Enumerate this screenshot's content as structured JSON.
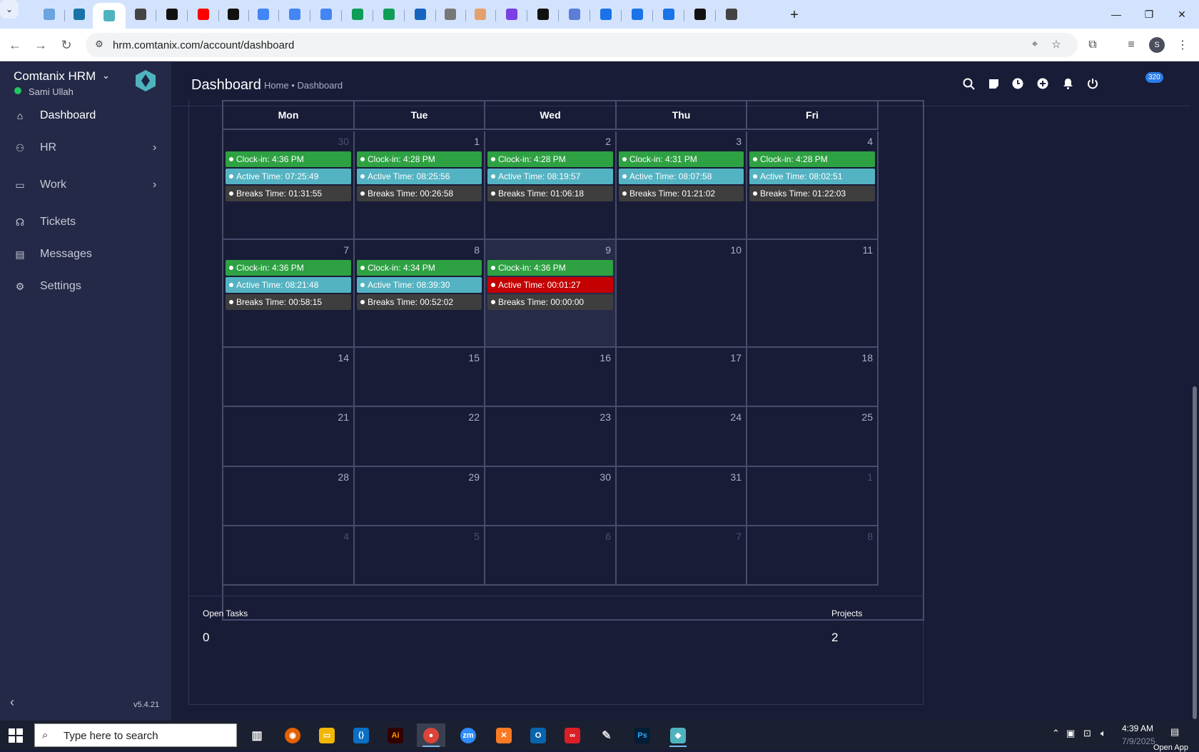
{
  "browser": {
    "url": "hrm.comtanix.com/account/dashboard",
    "new_tab_label": "+",
    "tabs": [
      {
        "icon": "edge-style-icon",
        "color": "#6aa3e0"
      },
      {
        "icon": "vpn-icon",
        "color": "#1a73a8"
      },
      {
        "icon": "hrm-app-icon",
        "color": "#4fb3bf",
        "active": true
      },
      {
        "icon": "audio-icon",
        "color": "#444"
      },
      {
        "icon": "openai-icon",
        "color": "#111"
      },
      {
        "icon": "youtube-icon",
        "color": "#ff0000"
      },
      {
        "icon": "bolt-icon",
        "color": "#111"
      },
      {
        "icon": "docs-icon",
        "color": "#4285f4"
      },
      {
        "icon": "docs-icon",
        "color": "#4285f4"
      },
      {
        "icon": "docs-icon",
        "color": "#4285f4"
      },
      {
        "icon": "sheets-icon",
        "color": "#0f9d58"
      },
      {
        "icon": "sheets-icon",
        "color": "#0f9d58"
      },
      {
        "icon": "text-tab-icon",
        "color": "#1565c0"
      },
      {
        "icon": "globe-icon",
        "color": "#777"
      },
      {
        "icon": "claude-icon",
        "color": "#e3a06b"
      },
      {
        "icon": "regex-icon",
        "color": "#7b3fe4"
      },
      {
        "icon": "code-icon",
        "color": "#111"
      },
      {
        "icon": "be-icon",
        "color": "#5b7fd6"
      },
      {
        "icon": "forms-icon",
        "color": "#1a73e8"
      },
      {
        "icon": "forms-icon",
        "color": "#1a73e8"
      },
      {
        "icon": "forms-icon",
        "color": "#1a73e8"
      },
      {
        "icon": "m-icon",
        "color": "#111"
      },
      {
        "icon": "audio-icon",
        "color": "#444"
      }
    ]
  },
  "sidebar": {
    "brand": "Comtanix HRM",
    "user": "Sami Ullah",
    "version": "v5.4.21",
    "items": [
      {
        "label": "Dashboard",
        "icon": "home-icon",
        "active": true
      },
      {
        "label": "HR",
        "icon": "people-icon",
        "arrow": true
      },
      {
        "label": "Work",
        "icon": "briefcase-icon",
        "arrow": true
      },
      {
        "label": "Tickets",
        "icon": "headset-icon"
      },
      {
        "label": "Messages",
        "icon": "message-icon"
      },
      {
        "label": "Settings",
        "icon": "gear-icon"
      }
    ]
  },
  "header": {
    "title": "Dashboard",
    "breadcrumb": "Home • Dashboard",
    "notification_count": "320"
  },
  "calendar": {
    "weekdays": [
      "Mon",
      "Tue",
      "Wed",
      "Thu",
      "Fri"
    ],
    "weeks": [
      [
        {
          "day": "30",
          "other": true,
          "events": {
            "clock": "Clock-in: 4:36 PM",
            "active": "Active Time: 07:25:49",
            "breaks": "Breaks Time: 01:31:55"
          }
        },
        {
          "day": "1",
          "events": {
            "clock": "Clock-in: 4:28 PM",
            "active": "Active Time: 08:25:56",
            "breaks": "Breaks Time: 00:26:58"
          }
        },
        {
          "day": "2",
          "events": {
            "clock": "Clock-in: 4:28 PM",
            "active": "Active Time: 08:19:57",
            "breaks": "Breaks Time: 01:06:18"
          }
        },
        {
          "day": "3",
          "events": {
            "clock": "Clock-in: 4:31 PM",
            "active": "Active Time: 08:07:58",
            "breaks": "Breaks Time: 01:21:02"
          }
        },
        {
          "day": "4",
          "events": {
            "clock": "Clock-in: 4:28 PM",
            "active": "Active Time: 08:02:51",
            "breaks": "Breaks Time: 01:22:03"
          }
        }
      ],
      [
        {
          "day": "7",
          "events": {
            "clock": "Clock-in: 4:36 PM",
            "active": "Active Time: 08:21:48",
            "breaks": "Breaks Time: 00:58:15"
          }
        },
        {
          "day": "8",
          "events": {
            "clock": "Clock-in: 4:34 PM",
            "active": "Active Time: 08:39:30",
            "breaks": "Breaks Time: 00:52:02"
          }
        },
        {
          "day": "9",
          "today": true,
          "events": {
            "clock": "Clock-in: 4:36 PM",
            "active": "Active Time: 00:01:27",
            "active_alert": true,
            "breaks": "Breaks Time: 00:00:00"
          }
        },
        {
          "day": "10"
        },
        {
          "day": "11"
        }
      ],
      [
        {
          "day": "14"
        },
        {
          "day": "15"
        },
        {
          "day": "16"
        },
        {
          "day": "17"
        },
        {
          "day": "18"
        }
      ],
      [
        {
          "day": "21"
        },
        {
          "day": "22"
        },
        {
          "day": "23"
        },
        {
          "day": "24"
        },
        {
          "day": "25"
        }
      ],
      [
        {
          "day": "28"
        },
        {
          "day": "29"
        },
        {
          "day": "30"
        },
        {
          "day": "31"
        },
        {
          "day": "1",
          "other": true
        }
      ],
      [
        {
          "day": "4",
          "other": true
        },
        {
          "day": "5",
          "other": true
        },
        {
          "day": "6",
          "other": true
        },
        {
          "day": "7",
          "other": true
        },
        {
          "day": "8",
          "other": true
        }
      ]
    ]
  },
  "stats": {
    "open_tasks_label": "Open Tasks",
    "open_tasks_value": "0",
    "projects_label": "Projects",
    "projects_value": "2"
  },
  "taskbar": {
    "search_placeholder": "Type here to search",
    "time": "4:39 AM",
    "date": "7/9/2025",
    "open_app": "Open App"
  }
}
